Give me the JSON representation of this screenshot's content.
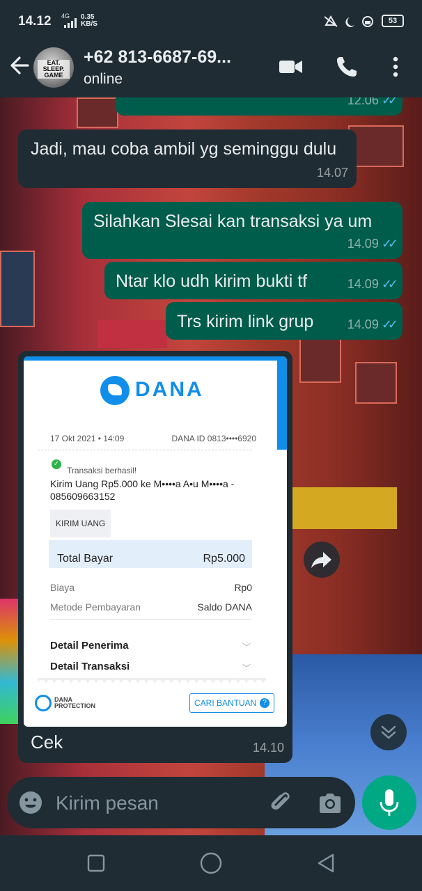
{
  "status_bar": {
    "time": "14.12",
    "network": "4G",
    "speed_value": "0.35",
    "speed_unit": "KB/S",
    "battery": "53"
  },
  "header": {
    "contact_name": "+62 813-6687-69...",
    "status": "online",
    "avatar_text": "EAT. SLEEP. GAME"
  },
  "messages": [
    {
      "dir": "out",
      "text": "",
      "time": "12.06"
    },
    {
      "dir": "in",
      "text": "Jadi, mau coba ambil yg seminggu dulu",
      "time": "14.07"
    },
    {
      "dir": "out",
      "text": "Silahkan Slesai kan transaksi ya um",
      "time": "14.09"
    },
    {
      "dir": "out",
      "text": "Ntar klo udh kirim bukti tf",
      "time": "14.09"
    },
    {
      "dir": "out",
      "text": "Trs kirim link grup",
      "time": "14.09"
    },
    {
      "dir": "in",
      "text": "Cek",
      "time": "14.10"
    }
  ],
  "receipt": {
    "brand": "DANA",
    "date": "17 Okt 2021 • 14:09",
    "dana_id": "DANA ID 0813••••6920",
    "status": "Transaksi berhasil!",
    "description": "Kirim Uang Rp5.000 ke M••••a A•u M••••a - 085609663152",
    "type_badge": "KIRIM UANG",
    "total_label": "Total Bayar",
    "total_value": "Rp5.000",
    "fee_label": "Biaya",
    "fee_value": "Rp0",
    "method_label": "Metode Pembayaran",
    "method_value": "Saldo DANA",
    "section_recipient": "Detail Penerima",
    "section_transaction": "Detail Transaksi",
    "protection_line1": "DANA",
    "protection_line2": "PROTECTION",
    "help_button": "CARI BANTUAN",
    "side_mark": "DANA"
  },
  "input": {
    "placeholder": "Kirim pesan"
  },
  "colors": {
    "outgoing_bubble": "#005c4b",
    "incoming_bubble": "#1f2c34",
    "read_ticks": "#53bdeb",
    "dana_blue": "#118eea",
    "mic_button": "#00a884"
  },
  "icons": {
    "back": "arrow-left-icon",
    "video": "video-call-icon",
    "call": "phone-icon",
    "menu": "more-vert-icon",
    "forward": "forward-icon",
    "scroll_down": "chevron-double-down-icon",
    "emoji": "emoji-icon",
    "attach": "paperclip-icon",
    "camera": "camera-icon",
    "mic": "mic-icon"
  }
}
